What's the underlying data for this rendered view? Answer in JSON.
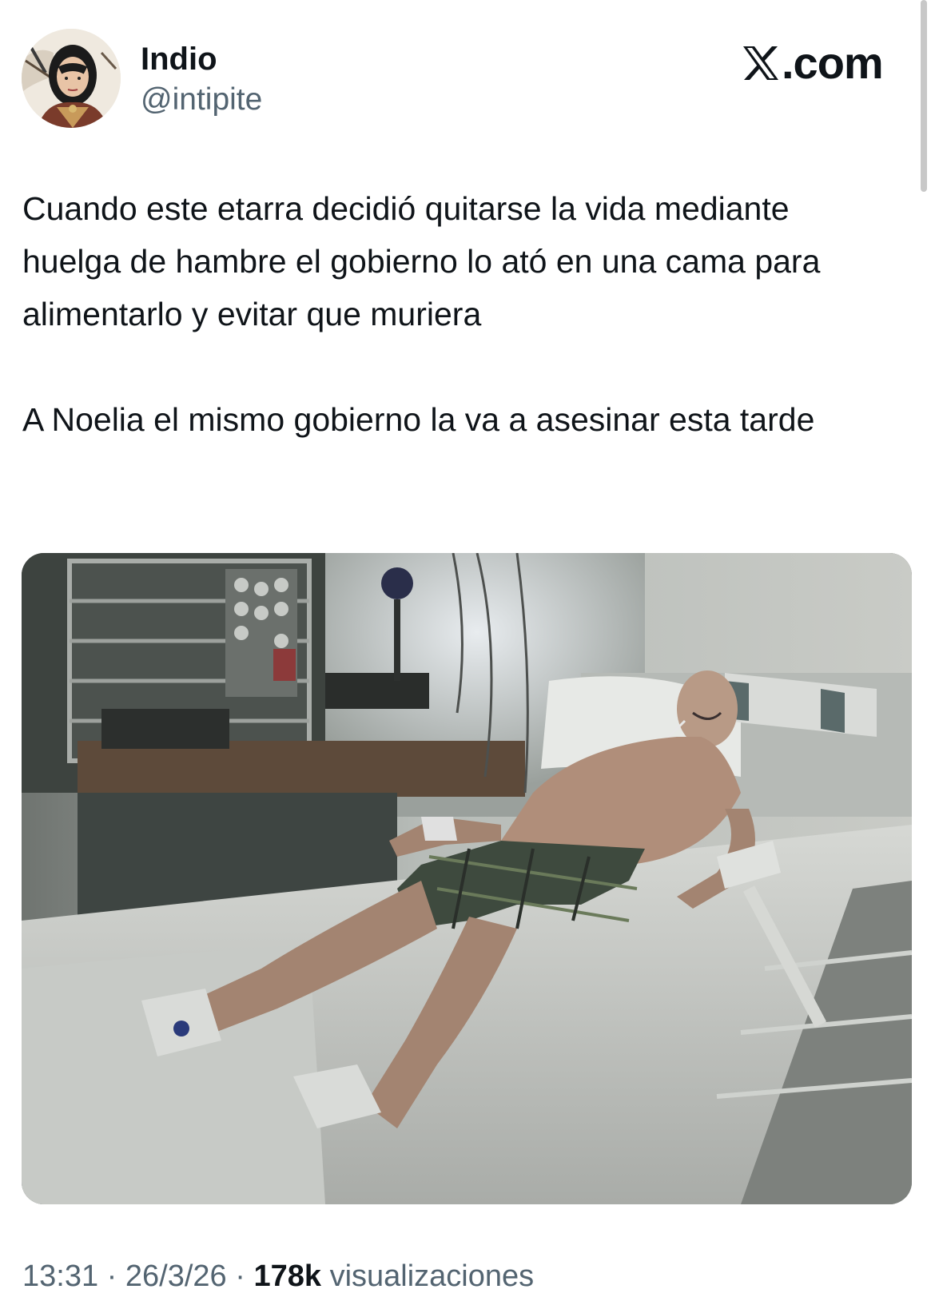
{
  "author": {
    "name": "Indio",
    "handle": "@intipite"
  },
  "brand": {
    "logo_text": ".com",
    "logo_icon": "x-logo-icon"
  },
  "tweet": {
    "paragraphs": [
      "Cuando este etarra decidió quitarse la vida mediante huelga de hambre el gobierno lo ató en una cama para alimentarlo y evitar que muriera",
      "A Noelia el mismo gobierno la va a asesinar esta tarde"
    ]
  },
  "meta": {
    "time": "13:31",
    "separator": "·",
    "date": "26/3/26",
    "views_count": "178k",
    "views_label": "visualizaciones"
  },
  "colors": {
    "text_primary": "#0f1419",
    "text_secondary": "#536471",
    "background": "#ffffff"
  }
}
